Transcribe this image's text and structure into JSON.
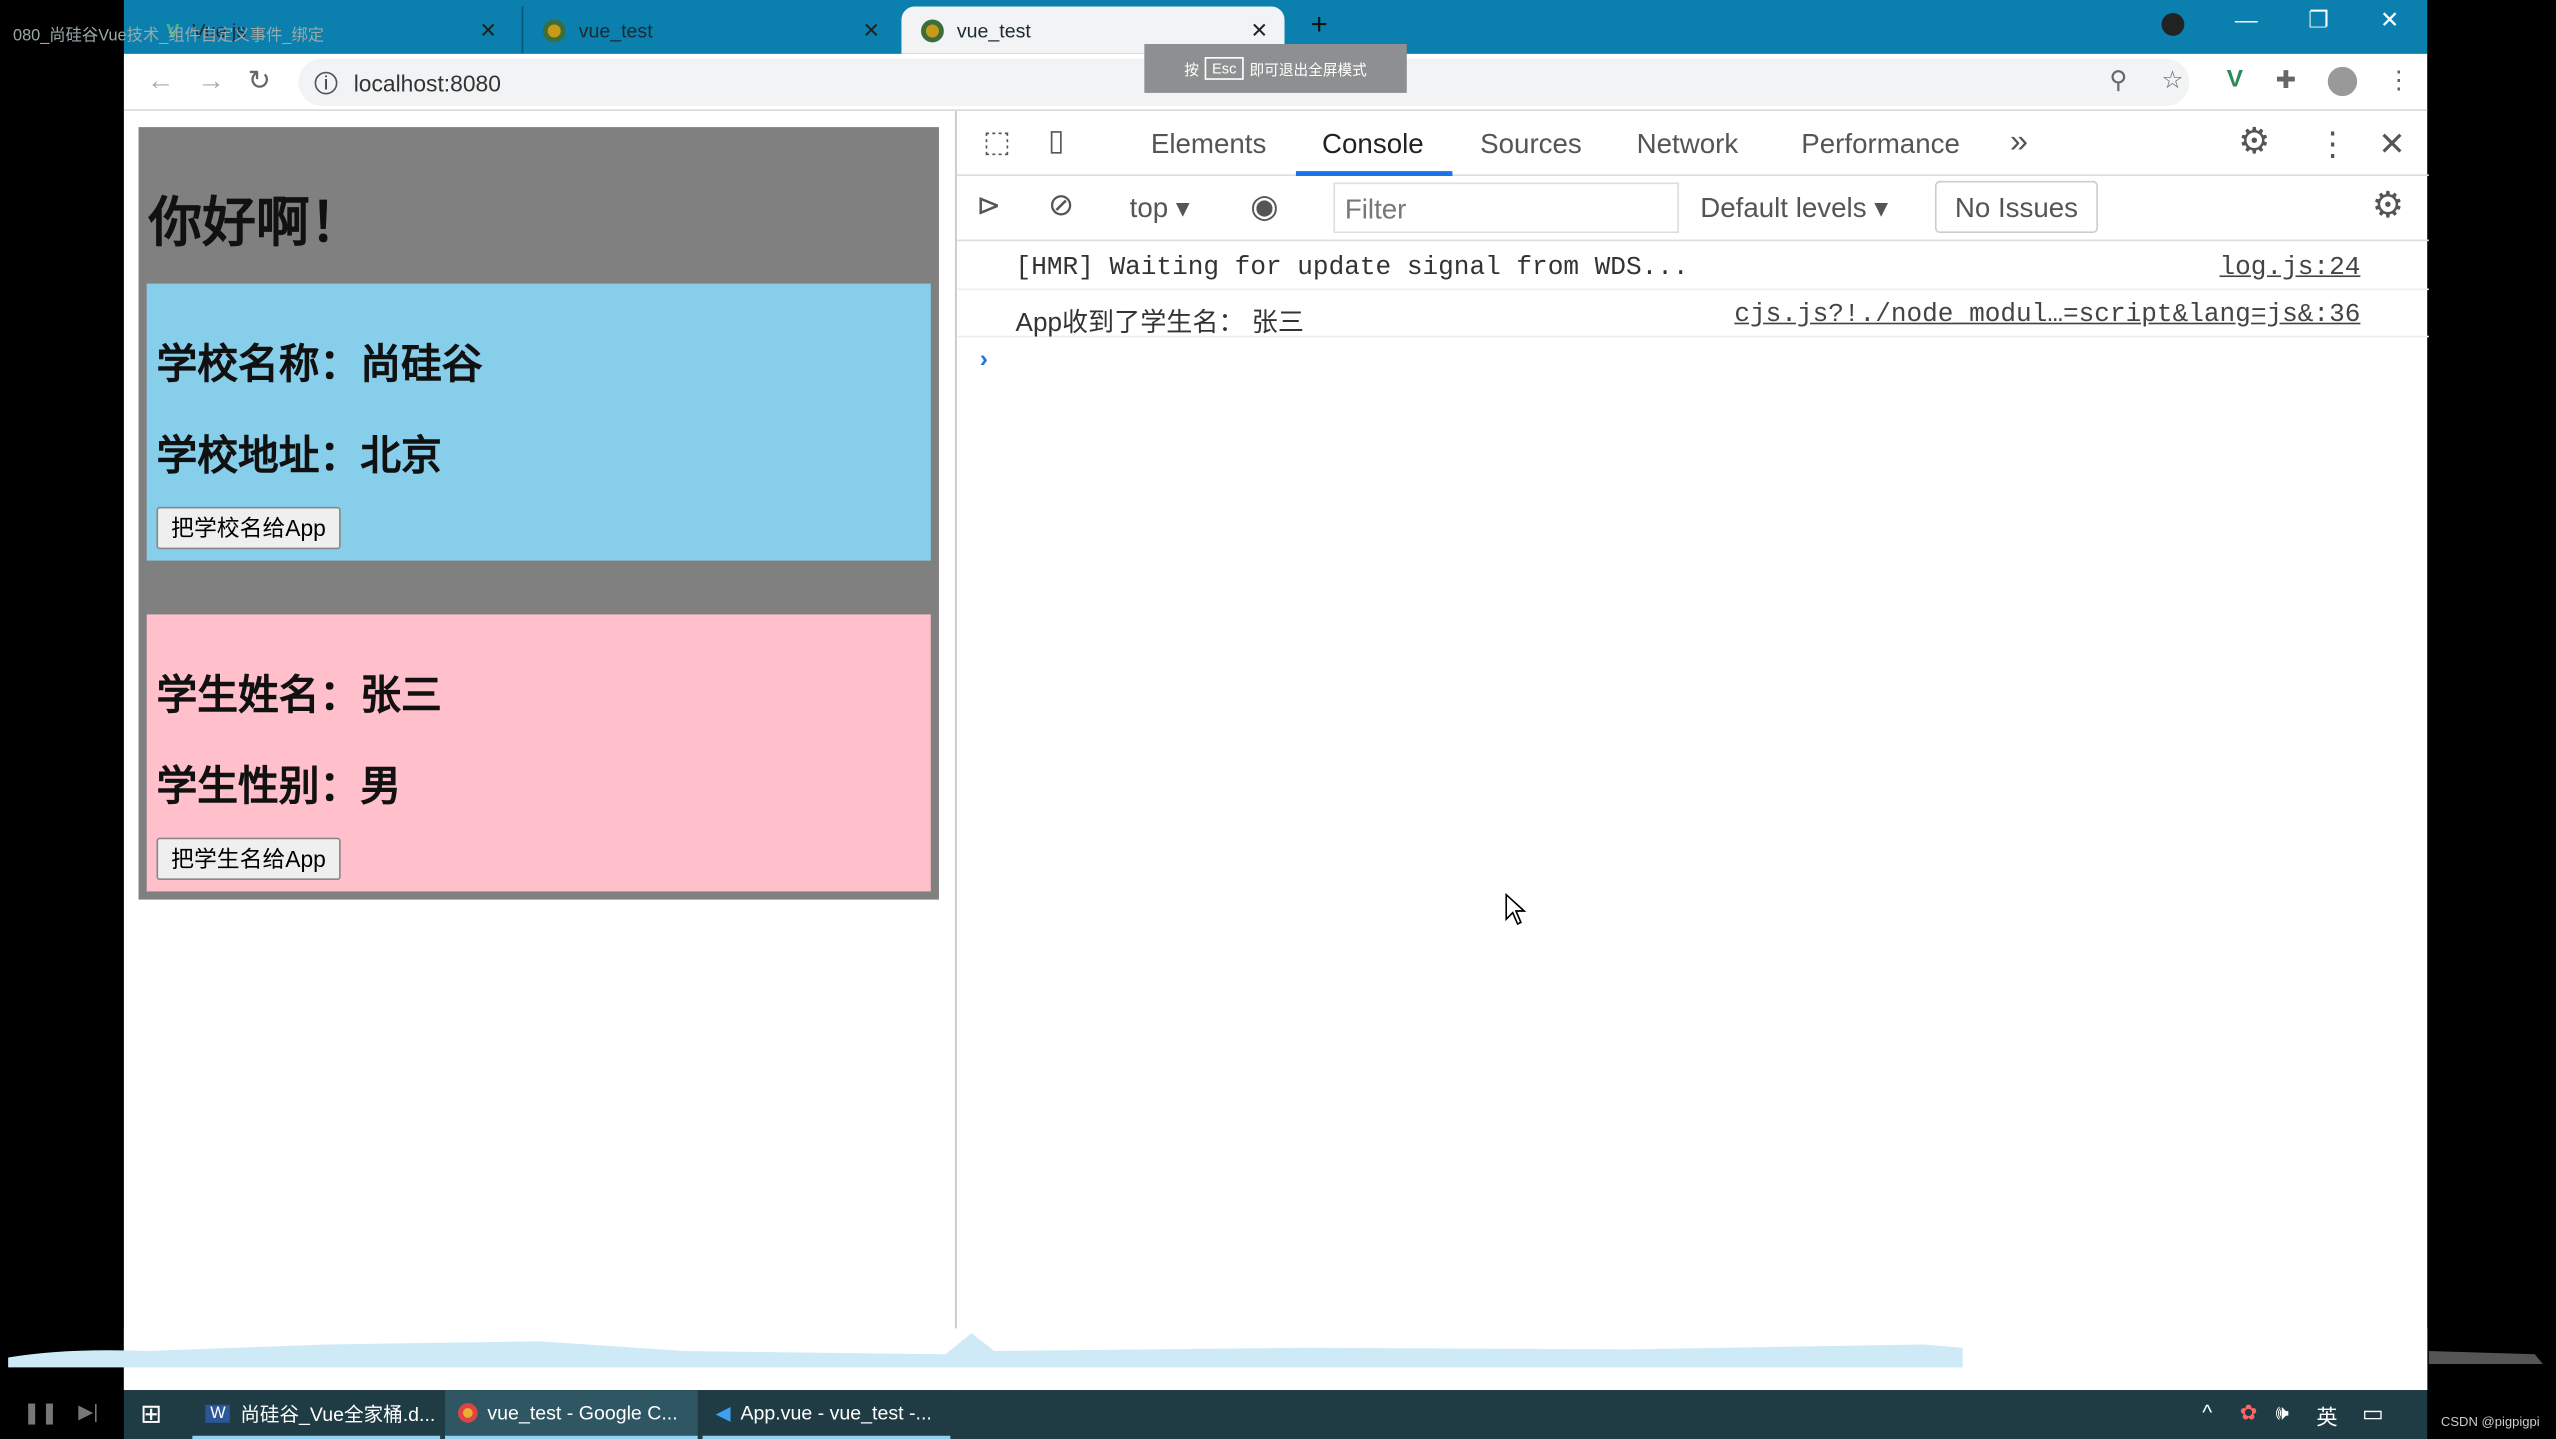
{
  "overlay_title": "080_尚硅谷Vue技术_组件自定义事件_绑定",
  "browser": {
    "tabs": [
      {
        "label": "Vue.js",
        "active": false
      },
      {
        "label": "vue_test",
        "active": false
      },
      {
        "label": "vue_test",
        "active": true
      }
    ],
    "url": "localhost:8080",
    "fullscreen_hint": {
      "prefix": "按",
      "key": "Esc",
      "suffix": "即可退出全屏模式"
    }
  },
  "page": {
    "title": "你好啊！",
    "school": {
      "name": "学校名称：尚硅谷",
      "address": "学校地址：北京",
      "button": "把学校名给App",
      "color": "#87ceeb"
    },
    "student": {
      "name": "学生姓名：张三",
      "gender": "学生性别：男",
      "button": "把学生名给App",
      "color": "#ffc0cb"
    },
    "app_bg": "#808080"
  },
  "devtools": {
    "tabs": [
      "Elements",
      "Console",
      "Sources",
      "Network",
      "Performance"
    ],
    "active_tab": "Console",
    "context": "top",
    "filter_placeholder": "Filter",
    "levels": "Default levels",
    "issues": "No Issues",
    "messages": [
      {
        "text": "[HMR] Waiting for update signal from WDS...",
        "source": "log.js:24"
      },
      {
        "text": "App收到了学生名： 张三",
        "source": "cjs.js?!./node_modul…=script&lang=js&:36"
      }
    ]
  },
  "taskbar": {
    "items": [
      "尚硅谷_Vue全家桶.d...",
      "vue_test - Google C...",
      "App.vue - vue_test -..."
    ],
    "ime": "英",
    "watermark": "CSDN @pigpigpi"
  }
}
